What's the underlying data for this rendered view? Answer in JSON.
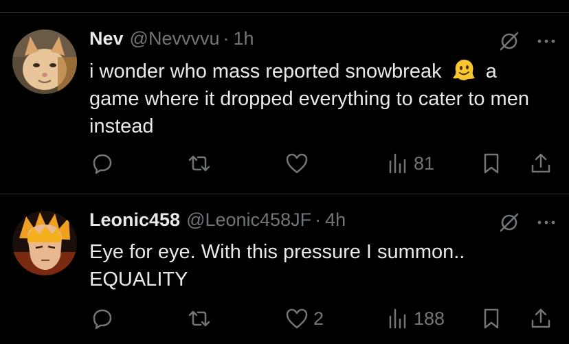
{
  "tweets": [
    {
      "name": "Nev",
      "handle": "@Nevvvvu",
      "separator": "·",
      "time": "1h",
      "text_before_emoji": "i wonder who mass reported snowbreak",
      "text_after_emoji": "a game where it dropped everything to cater to men instead",
      "emoji": "melting-face-emoji",
      "reply_count": "",
      "retweet_count": "",
      "like_count": "",
      "views": "81"
    },
    {
      "name": "Leonic458",
      "handle": "@Leonic458JF",
      "separator": "·",
      "time": "4h",
      "text_before_emoji": "Eye for eye. With this pressure I summon.. EQUALITY",
      "text_after_emoji": "",
      "emoji": "",
      "reply_count": "",
      "retweet_count": "",
      "like_count": "2",
      "views": "188"
    }
  ],
  "colors": {
    "background": "#000000",
    "primary_text": "#e7e9ea",
    "secondary_text": "#71767b",
    "divider": "#2f3336"
  }
}
